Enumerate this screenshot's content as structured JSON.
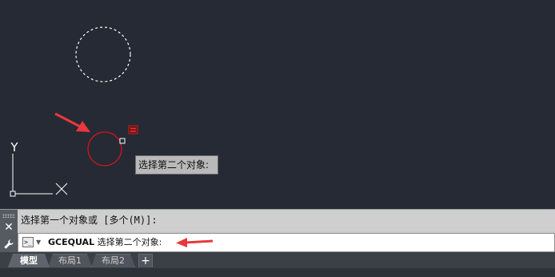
{
  "canvas": {
    "tooltip_text": "选择第二个对象:",
    "ucs_label": "Y",
    "colors": {
      "background": "#252a34",
      "ghost_circle": "#ffffff",
      "selected_circle": "#d9141b",
      "arrow": "#e8383d",
      "axis": "#ffffff"
    }
  },
  "command_panel": {
    "history_line": "选择第一个对象或 [多个(M)]:",
    "prompt_icon": ">_",
    "command_name": "GCEQUAL",
    "command_prompt": "选择第二个对象:"
  },
  "layout_tabs": {
    "tabs": [
      {
        "label": "模型",
        "active": true
      },
      {
        "label": "布局1",
        "active": false
      },
      {
        "label": "布局2",
        "active": false
      }
    ],
    "add_label": "+"
  }
}
